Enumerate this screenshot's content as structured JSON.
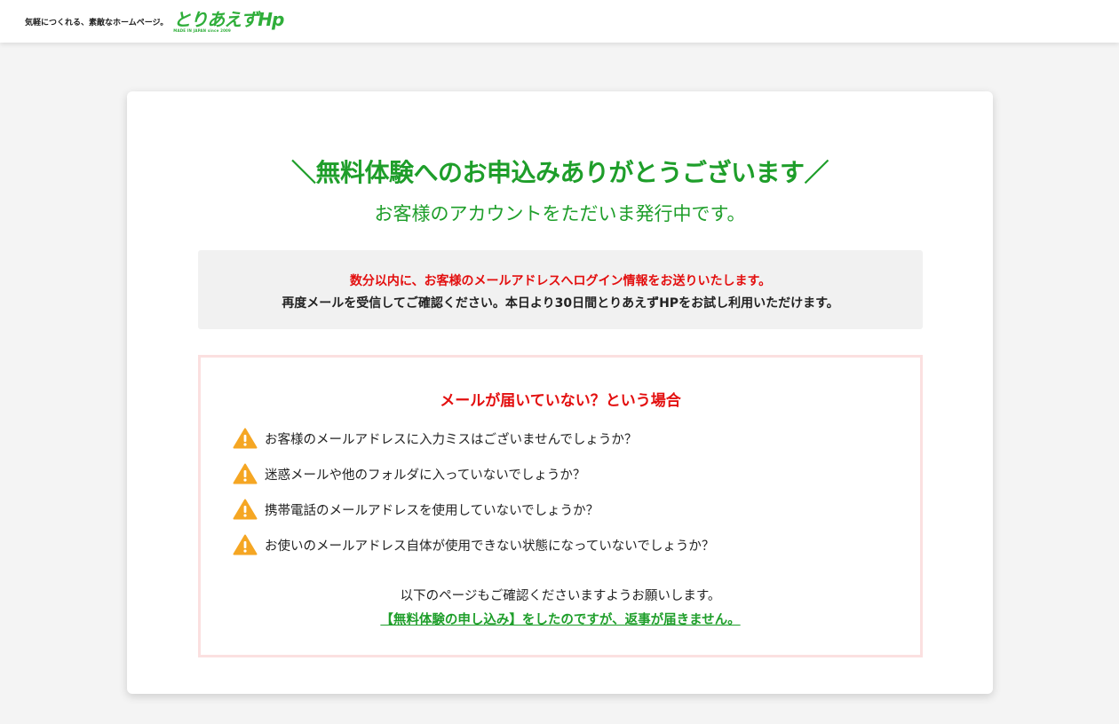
{
  "header": {
    "tagline": "気軽につくれる、素敵なホームページ。",
    "logo_text": "とりあえずHp",
    "logo_sub": "MADE IN JAPAN since 2009"
  },
  "main": {
    "title": "＼無料体験へのお申込みありがとうございます／",
    "subtitle": "お客様のアカウントをただいま発行中です。",
    "info": {
      "line1": "数分以内に、お客様のメールアドレスへログイン情報をお送りいたします。",
      "line2": "再度メールを受信してご確認ください。本日より30日間とりあえずHPをお試し利用いただけます。"
    },
    "faq": {
      "title": "メールが届いていない？という場合",
      "items": [
        {
          "icon": "warning-icon",
          "text": "お客様のメールアドレスに入力ミスはございませんでしょうか？"
        },
        {
          "icon": "warning-icon",
          "text": "迷惑メールや他のフォルダに入っていないでしょうか？"
        },
        {
          "icon": "warning-icon",
          "text": "携帯電話のメールアドレスを使用していないでしょうか？"
        },
        {
          "icon": "warning-icon",
          "text": "お使いのメールアドレス自体が使用できない状態になっていないでしょうか？"
        }
      ],
      "footer_text": "以下のページもご確認くださいますようお願いします。",
      "footer_link": "【無料体験の申し込み】をしたのですが、返事が届きません。"
    }
  },
  "colors": {
    "accent_green": "#1e9e2a",
    "alert_red": "#e30f0f",
    "warning_orange": "#f5a623",
    "faq_border": "#fbe0e0"
  }
}
